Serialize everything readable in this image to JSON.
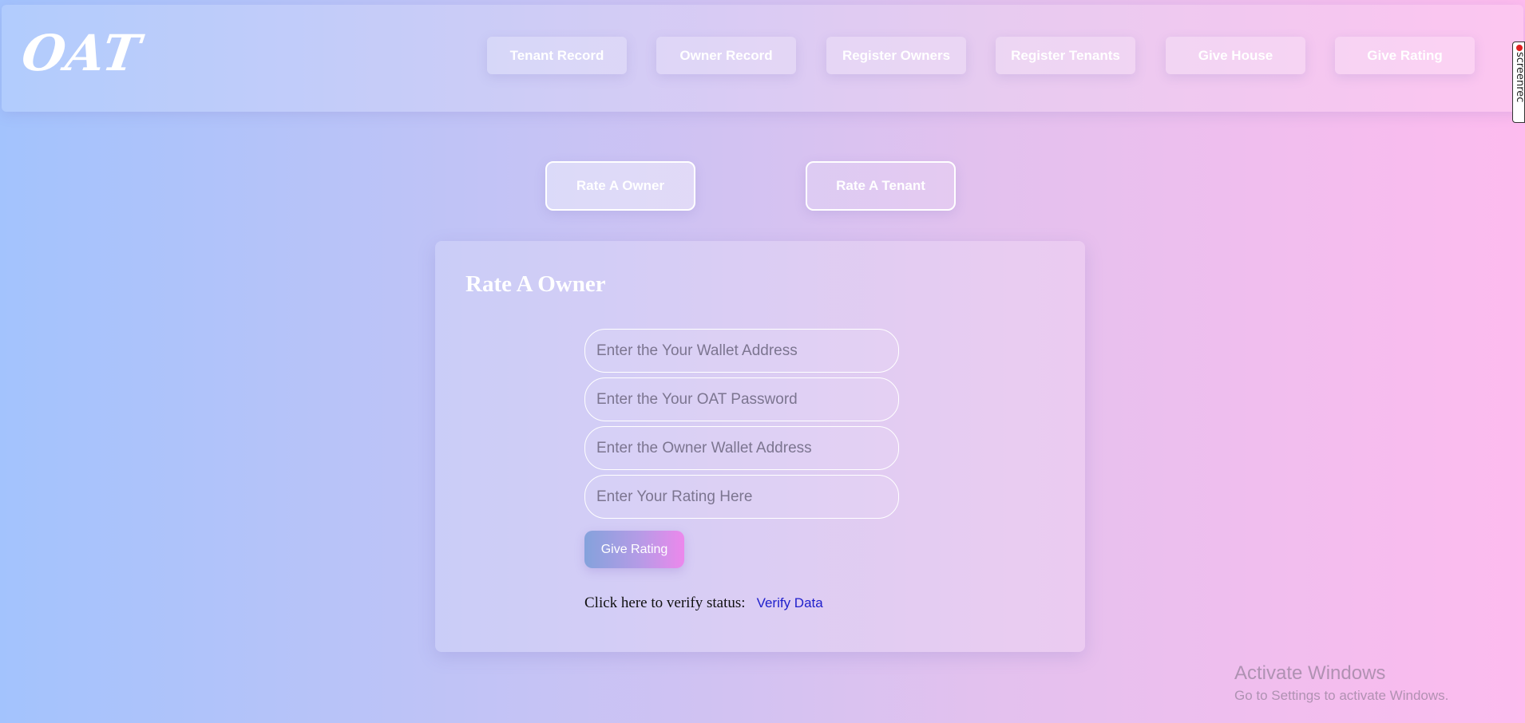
{
  "header": {
    "logo": "OAT",
    "nav": [
      {
        "label": "Tenant Record"
      },
      {
        "label": "Owner Record"
      },
      {
        "label": "Register Owners"
      },
      {
        "label": "Register Tenants"
      },
      {
        "label": "Give House"
      },
      {
        "label": "Give Rating"
      }
    ]
  },
  "overlay": {
    "screenrec_label": "screenrec"
  },
  "tabs": [
    {
      "label": "Rate A Owner",
      "active": true
    },
    {
      "label": "Rate A Tenant",
      "active": false
    }
  ],
  "form": {
    "title": "Rate A Owner",
    "fields": [
      {
        "placeholder": "Enter the Your Wallet Address",
        "value": ""
      },
      {
        "placeholder": "Enter the Your OAT Password",
        "value": ""
      },
      {
        "placeholder": "Enter the Owner Wallet Address",
        "value": ""
      },
      {
        "placeholder": "Enter Your Rating Here",
        "value": ""
      }
    ],
    "submit_label": "Give Rating",
    "verify_text": "Click here to verify status:",
    "verify_link": "Verify Data"
  },
  "watermark": {
    "title": "Activate Windows",
    "subtitle": "Go to Settings to activate Windows."
  },
  "colors": {
    "link": "#2020cc",
    "button_gradient_start": "#84a2dc",
    "button_gradient_end": "#ec88ec"
  }
}
